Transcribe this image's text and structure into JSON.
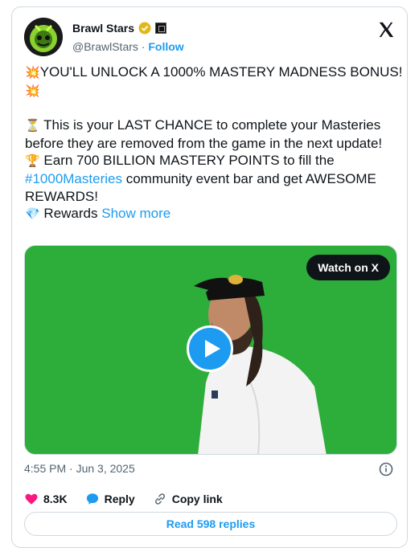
{
  "author": {
    "name": "Brawl Stars",
    "handle": "@BrawlStars",
    "separator": "·",
    "follow_label": "Follow"
  },
  "tweet": {
    "line1": "YOU'LL UNLOCK A 1000% MASTERY MADNESS BONUS!",
    "line2": "This is your LAST CHANCE to complete your Masteries before they are removed from the game in the next update!",
    "line3_pre": "Earn 700 BILLION MASTERY POINTS to fill the",
    "hashtag": "#1000Masteries",
    "line3_post": "community event bar and get AWESOME REWARDS!",
    "line4": "Rewards",
    "show_more": "Show more",
    "emoji": {
      "collision": "💥",
      "hourglass": "⏳",
      "trophy": "🏆",
      "gem": "💎"
    }
  },
  "video": {
    "watch_label": "Watch on X",
    "background_color": "#2dae3a"
  },
  "meta": {
    "timestamp": "4:55 PM · Jun 3, 2025"
  },
  "actions": {
    "like_count": "8.3K",
    "reply_label": "Reply",
    "copy_link_label": "Copy link"
  },
  "read_replies_label": "Read 598 replies",
  "colors": {
    "accent": "#1d9bf0",
    "like": "#f91880",
    "verified_gold": "#e2b719"
  }
}
